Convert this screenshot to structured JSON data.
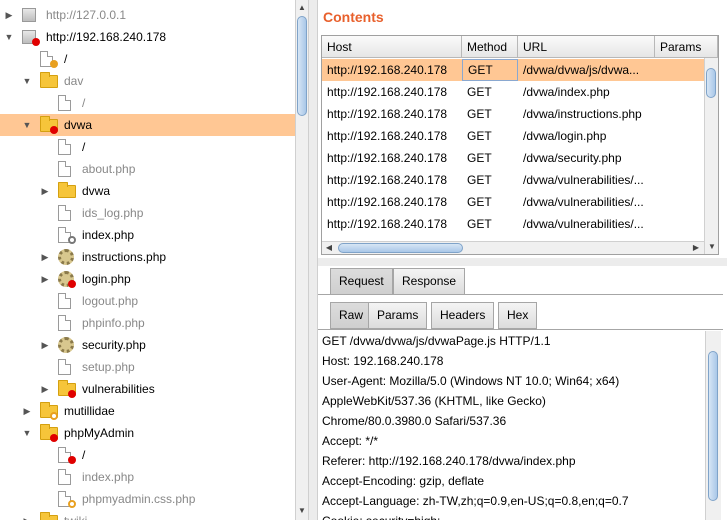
{
  "tree": {
    "items": [
      {
        "label": "http://127.0.0.1",
        "icon": "host-icon",
        "arrow": "▶",
        "gray": true,
        "depth": 0
      },
      {
        "label": "http://192.168.240.178",
        "icon": "host-icon",
        "arrow": "▼",
        "gray": false,
        "depth": 0,
        "badge": "red"
      },
      {
        "label": "/",
        "icon": "page-icon",
        "arrow": "",
        "gray": false,
        "depth": 1,
        "badge": "orange"
      },
      {
        "label": "dav",
        "icon": "folder-icon",
        "arrow": "▼",
        "gray": true,
        "depth": 1
      },
      {
        "label": "/",
        "icon": "page-icon",
        "arrow": "",
        "gray": true,
        "depth": 2
      },
      {
        "label": "dvwa",
        "icon": "folder-icon",
        "arrow": "▼",
        "gray": false,
        "depth": 1,
        "badge": "red",
        "selected": true
      },
      {
        "label": "/",
        "icon": "page-icon",
        "arrow": "",
        "gray": false,
        "depth": 2
      },
      {
        "label": "about.php",
        "icon": "page-icon",
        "arrow": "",
        "gray": true,
        "depth": 2
      },
      {
        "label": "dvwa",
        "icon": "folder-icon",
        "arrow": "▶",
        "gray": false,
        "depth": 2
      },
      {
        "label": "ids_log.php",
        "icon": "page-icon",
        "arrow": "",
        "gray": true,
        "depth": 2
      },
      {
        "label": "index.php",
        "icon": "page-icon",
        "arrow": "",
        "gray": false,
        "depth": 2,
        "badge": "ring-gray"
      },
      {
        "label": "instructions.php",
        "icon": "gear-icon",
        "arrow": "▶",
        "gray": false,
        "depth": 2
      },
      {
        "label": "login.php",
        "icon": "gear-icon",
        "arrow": "▶",
        "gray": false,
        "depth": 2,
        "badge": "red"
      },
      {
        "label": "logout.php",
        "icon": "page-icon",
        "arrow": "",
        "gray": true,
        "depth": 2
      },
      {
        "label": "phpinfo.php",
        "icon": "page-icon",
        "arrow": "",
        "gray": true,
        "depth": 2
      },
      {
        "label": "security.php",
        "icon": "gear-icon",
        "arrow": "▶",
        "gray": false,
        "depth": 2
      },
      {
        "label": "setup.php",
        "icon": "page-icon",
        "arrow": "",
        "gray": true,
        "depth": 2
      },
      {
        "label": "vulnerabilities",
        "icon": "folder-icon",
        "arrow": "▶",
        "gray": false,
        "depth": 2,
        "badge": "red"
      },
      {
        "label": "mutillidae",
        "icon": "folder-icon",
        "arrow": "▶",
        "gray": false,
        "depth": 1,
        "badge": "ring"
      },
      {
        "label": "phpMyAdmin",
        "icon": "folder-icon",
        "arrow": "▼",
        "gray": false,
        "depth": 1,
        "badge": "red"
      },
      {
        "label": "/",
        "icon": "page-icon",
        "arrow": "",
        "gray": false,
        "depth": 2,
        "badge": "red"
      },
      {
        "label": "index.php",
        "icon": "page-icon",
        "arrow": "",
        "gray": true,
        "depth": 2
      },
      {
        "label": "phpmyadmin.css.php",
        "icon": "page-icon",
        "arrow": "",
        "gray": true,
        "depth": 2,
        "badge": "ring"
      },
      {
        "label": "twiki",
        "icon": "folder-icon",
        "arrow": "▶",
        "gray": true,
        "depth": 1
      }
    ]
  },
  "contents": {
    "title": "Contents",
    "columns": [
      "Host",
      "Method",
      "URL",
      "Params"
    ],
    "rows": [
      {
        "host": "http://192.168.240.178",
        "method": "GET",
        "url": "/dvwa/dvwa/js/dvwa...",
        "selected": true
      },
      {
        "host": "http://192.168.240.178",
        "method": "GET",
        "url": "/dvwa/index.php"
      },
      {
        "host": "http://192.168.240.178",
        "method": "GET",
        "url": "/dvwa/instructions.php"
      },
      {
        "host": "http://192.168.240.178",
        "method": "GET",
        "url": "/dvwa/login.php"
      },
      {
        "host": "http://192.168.240.178",
        "method": "GET",
        "url": "/dvwa/security.php"
      },
      {
        "host": "http://192.168.240.178",
        "method": "GET",
        "url": "/dvwa/vulnerabilities/..."
      },
      {
        "host": "http://192.168.240.178",
        "method": "GET",
        "url": "/dvwa/vulnerabilities/..."
      },
      {
        "host": "http://192.168.240.178",
        "method": "GET",
        "url": "/dvwa/vulnerabilities/..."
      }
    ]
  },
  "tabs": {
    "main": [
      "Request",
      "Response"
    ],
    "sub": [
      "Raw",
      "Params",
      "Headers",
      "Hex"
    ]
  },
  "raw": {
    "lines": [
      "GET /dvwa/dvwa/js/dvwaPage.js HTTP/1.1",
      "Host: 192.168.240.178",
      "User-Agent: Mozilla/5.0 (Windows NT 10.0; Win64; x64)",
      "AppleWebKit/537.36 (KHTML, like Gecko)",
      "Chrome/80.0.3980.0 Safari/537.36",
      "Accept: */*",
      "Referer: http://192.168.240.178/dvwa/index.php",
      "Accept-Encoding: gzip, deflate",
      "Accept-Language: zh-TW,zh;q=0.9,en-US;q=0.8,en;q=0.7",
      "Cookie: security=high;"
    ]
  },
  "colors": {
    "accent": "#e8602c",
    "selection": "#ffc794"
  }
}
